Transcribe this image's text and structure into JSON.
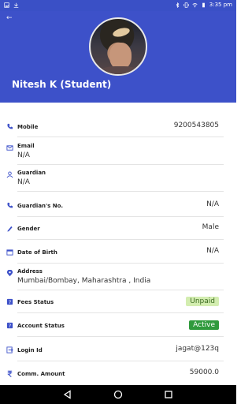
{
  "status_bar": {
    "time": "3:35 pm",
    "icons": [
      "image-icon",
      "download-icon",
      "bluetooth-icon",
      "vibrate-icon",
      "wifi-icon",
      "battery-icon"
    ]
  },
  "profile": {
    "name": "Nitesh K (Student)"
  },
  "fields": [
    {
      "label": "Mobile",
      "value": "9200543805",
      "icon": "phone-icon"
    },
    {
      "label": "Email",
      "value": "N/A",
      "icon": "mail-icon"
    },
    {
      "label": "Guardian",
      "value": "N/A",
      "icon": "person-icon"
    },
    {
      "label": "Guardian's No.",
      "value": "N/A",
      "icon": "phone-icon"
    },
    {
      "label": "Gender",
      "value": "Male",
      "icon": "pen-icon"
    },
    {
      "label": "Date of Birth",
      "value": "N/A",
      "icon": "calendar-icon"
    },
    {
      "label": "Address",
      "value": "Mumbai/Bombay, Maharashtra , India",
      "icon": "location-icon"
    },
    {
      "label": "Fees Status",
      "value": "Unpaid",
      "icon": "help-icon"
    },
    {
      "label": "Account Status",
      "value": "Active",
      "icon": "help-icon"
    },
    {
      "label": "Login Id",
      "value": "jagat@123q",
      "icon": "login-icon"
    },
    {
      "label": "Comm. Amount",
      "value": "59000.0",
      "icon": "rupee-icon"
    }
  ],
  "colors": {
    "primary": "#3d51c9",
    "unpaid_bg": "#d3edb0",
    "active_bg": "#2f9a3c"
  }
}
